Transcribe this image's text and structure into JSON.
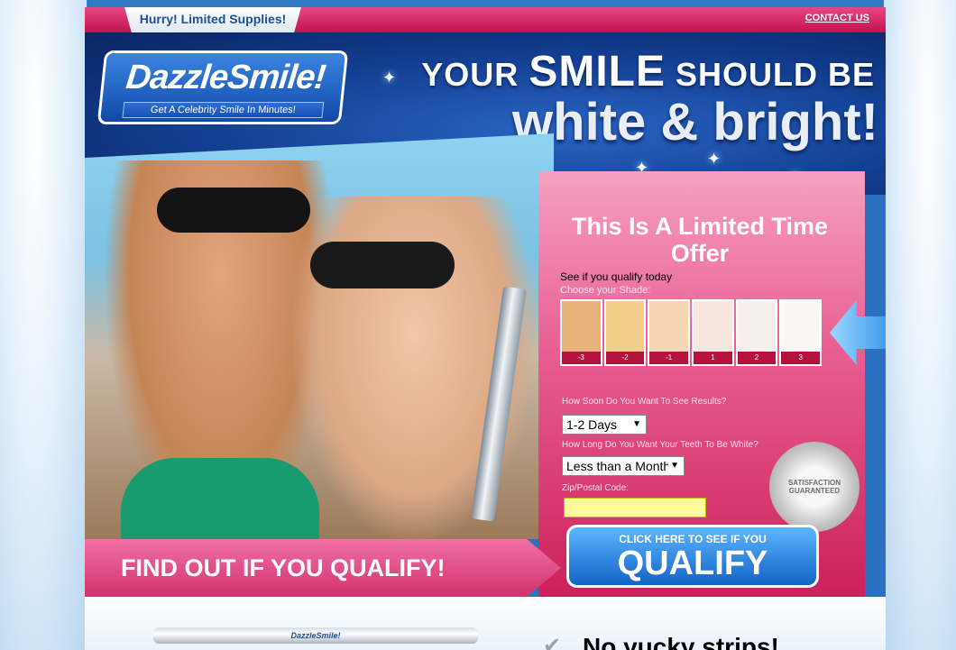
{
  "topbar": {
    "hurry_label": "Hurry! Limited Supplies!",
    "contact_label": "CONTACT US"
  },
  "header": {
    "logo_name": "DazzleSmile!",
    "logo_tagline": "Get A Celebrity Smile In Minutes!",
    "headline_line1_a": "YOUR ",
    "headline_line1_b": "SMILE",
    "headline_line1_c": " SHOULD BE",
    "headline_line2": "white & bright!"
  },
  "form": {
    "title": "This Is A Limited Time Offer",
    "subtitle": "See if you qualify today",
    "shade_label": "Choose your Shade:",
    "shades": [
      {
        "num": "-3",
        "color": "#e8b37a"
      },
      {
        "num": "-2",
        "color": "#f3cd8a"
      },
      {
        "num": "-1",
        "color": "#f6d6b3"
      },
      {
        "num": "1",
        "color": "#f7e7df"
      },
      {
        "num": "2",
        "color": "#f5f0ee"
      },
      {
        "num": "3",
        "color": "#f9f6f5"
      }
    ],
    "q1_label": "How Soon Do You Want To See Results?",
    "q1_value": "1-2 Days",
    "q2_label": "How Long Do You Want Your Teeth To Be White?",
    "q2_value": "Less than a Month",
    "zip_label": "Zip/Postal Code:",
    "zip_value": "",
    "seal_text": "SATISFACTION GUARANTEED"
  },
  "cta": {
    "banner_text": "FIND OUT IF YOU QUALIFY!",
    "button_top": "CLICK HERE TO SEE IF YOU",
    "button_main": "QUALIFY"
  },
  "bottom": {
    "pen_label": "DazzleSmile!",
    "strips_text": "No yucky strips!"
  }
}
